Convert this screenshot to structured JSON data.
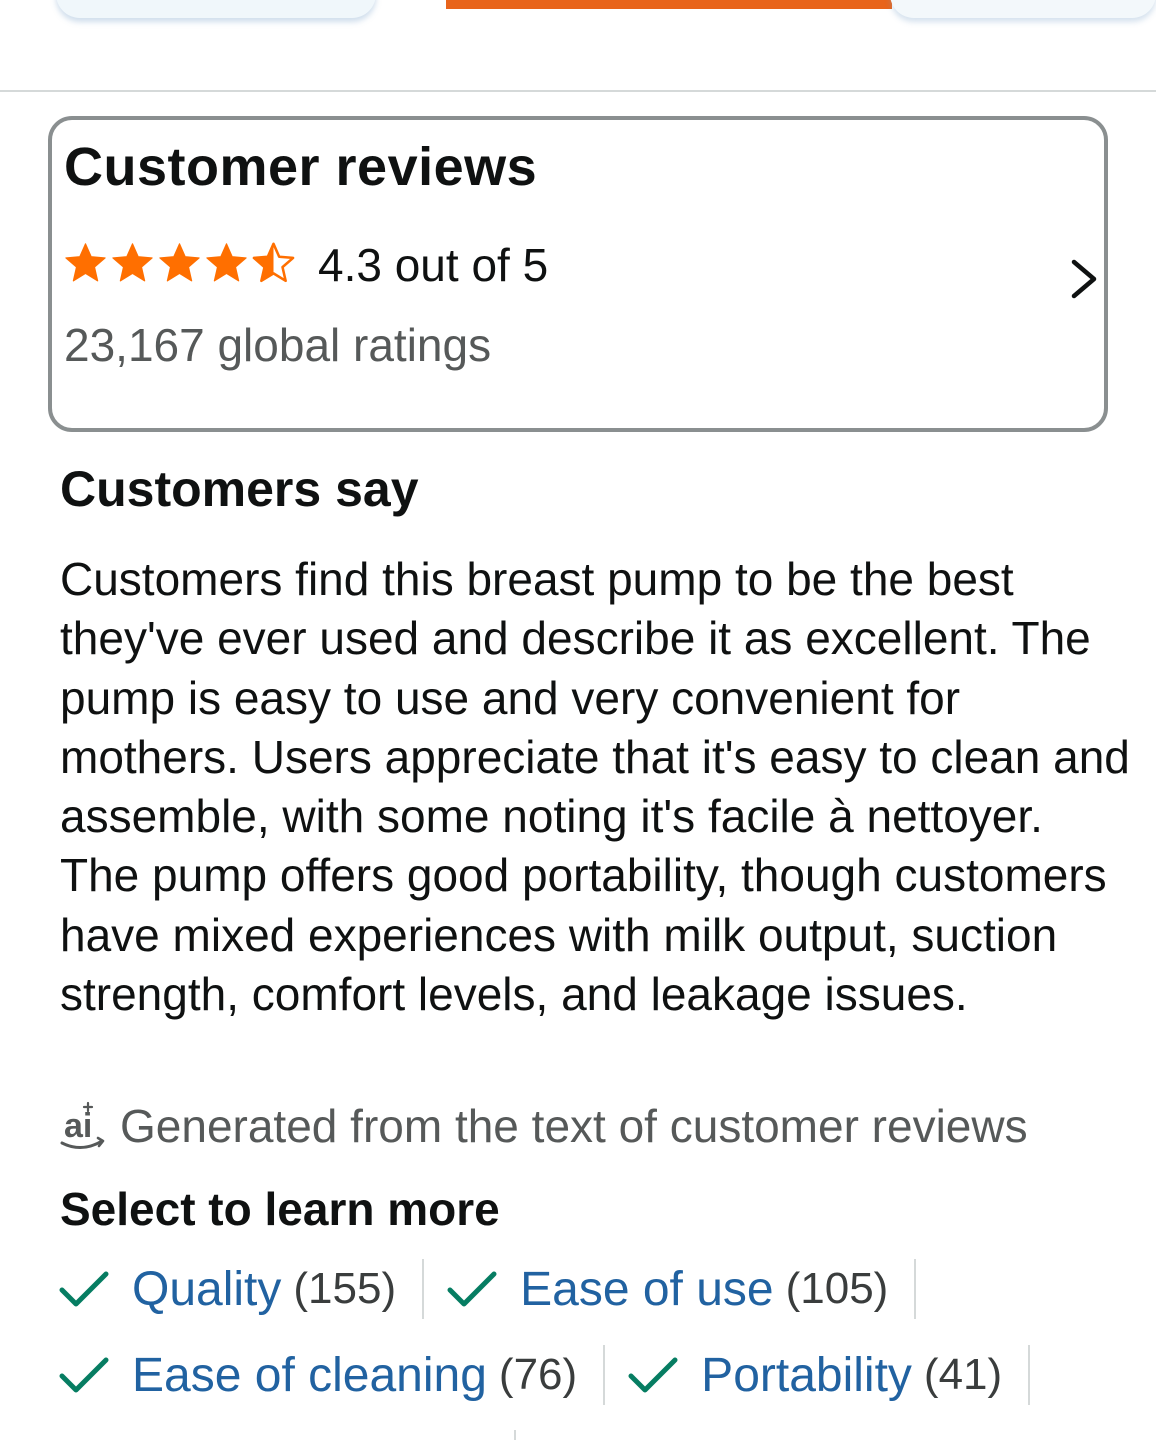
{
  "tabs": {
    "active_color": "#e8641b"
  },
  "reviews_card": {
    "title": "Customer reviews",
    "rating": 4.3,
    "stars_max": 5,
    "rating_text": "4.3 out of 5",
    "global_ratings": "23,167 global ratings",
    "star_color": "#ff6f00",
    "chevron_icon": "chevron-right-icon"
  },
  "customers_say": {
    "heading": "Customers say",
    "summary": "Customers find this breast pump to be the best they've ever used and describe it as excellent. The pump is easy to use and very convenient for mothers. Users appreciate that it's easy to clean and assemble, with some noting it's facile à nettoyer. The pump offers good portability, though customers have mixed experiences with milk output, suction strength, comfort levels, and leakage issues.",
    "ai_icon": "ai-icon",
    "ai_note": "Generated from the text of customer reviews"
  },
  "learn_more": {
    "heading": "Select to learn more",
    "check_color": "#067d62",
    "link_color": "#2162a1",
    "aspects": [
      {
        "label": "Quality",
        "count": "(155)"
      },
      {
        "label": "Ease of use",
        "count": "(105)"
      },
      {
        "label": "Ease of cleaning",
        "count": "(76)"
      },
      {
        "label": "Portability",
        "count": "(41)"
      }
    ]
  }
}
